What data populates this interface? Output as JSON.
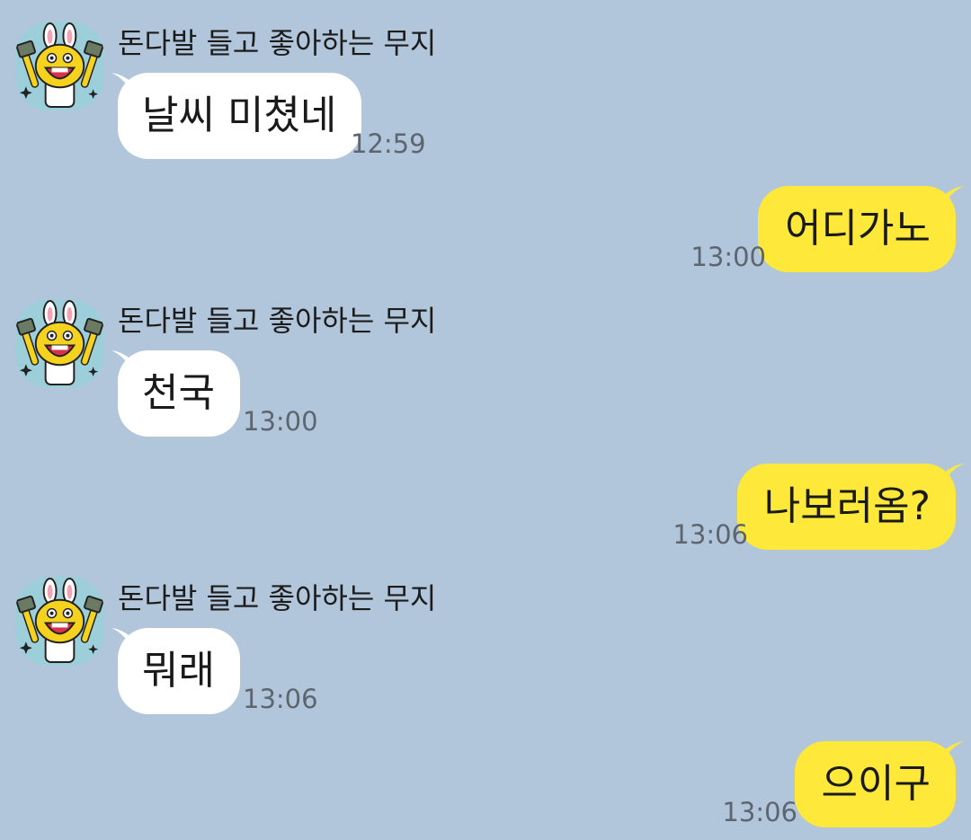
{
  "colors": {
    "background": "#b1c6da",
    "incoming_bubble": "#ffffff",
    "outgoing_bubble": "#fee93b",
    "timestamp": "#5d6670",
    "avatar_bg": "#9ccfd9"
  },
  "avatar_icon": "muzi-character-icon",
  "messages": [
    {
      "direction": "incoming",
      "sender": "돈다발 들고 좋아하는 무지",
      "text": "날씨 미쳤네",
      "time": "12:59"
    },
    {
      "direction": "outgoing",
      "text": "어디가노",
      "time": "13:00"
    },
    {
      "direction": "incoming",
      "sender": "돈다발 들고 좋아하는 무지",
      "text": "천국",
      "time": "13:00"
    },
    {
      "direction": "outgoing",
      "text": "나보러옴?",
      "time": "13:06"
    },
    {
      "direction": "incoming",
      "sender": "돈다발 들고 좋아하는 무지",
      "text": "뭐래",
      "time": "13:06"
    },
    {
      "direction": "outgoing",
      "text": "으이구",
      "time": "13:06"
    }
  ]
}
